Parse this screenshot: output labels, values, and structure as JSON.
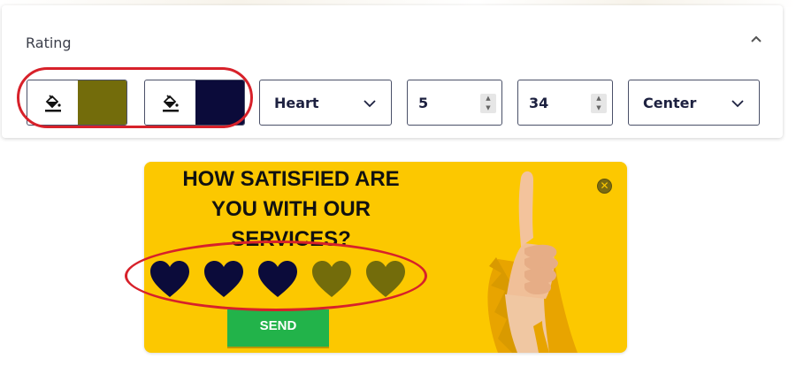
{
  "panel": {
    "title": "Rating",
    "collapse_icon": "chevron-up-icon"
  },
  "controls": {
    "fill_color_1": {
      "icon": "paint-bucket-icon",
      "swatch": "#736c0b"
    },
    "fill_color_2": {
      "icon": "paint-bucket-icon",
      "swatch": "#0b0b3a"
    },
    "shape_select": {
      "value": "Heart",
      "icon": "chevron-down-icon"
    },
    "count_input": {
      "value": "5"
    },
    "size_input": {
      "value": "34"
    },
    "align_select": {
      "value": "Center",
      "icon": "chevron-down-icon"
    }
  },
  "popup": {
    "title": "HOW SATISFIED ARE YOU WITH OUR SERVICES?",
    "title_lines": [
      "HOW SATISFIED ARE",
      "YOU WITH OUR",
      "SERVICES?"
    ],
    "background": "#fcc800",
    "close_icon": "close-icon",
    "rating": {
      "value": 3,
      "max": 5,
      "shape": "heart",
      "active_color": "#0b0b3a",
      "inactive_color": "#736c0b"
    },
    "send_label": "SEND",
    "send_color": "#22b34a",
    "image": "thumbs-up-hand"
  },
  "annotation_color": "#d7212a"
}
